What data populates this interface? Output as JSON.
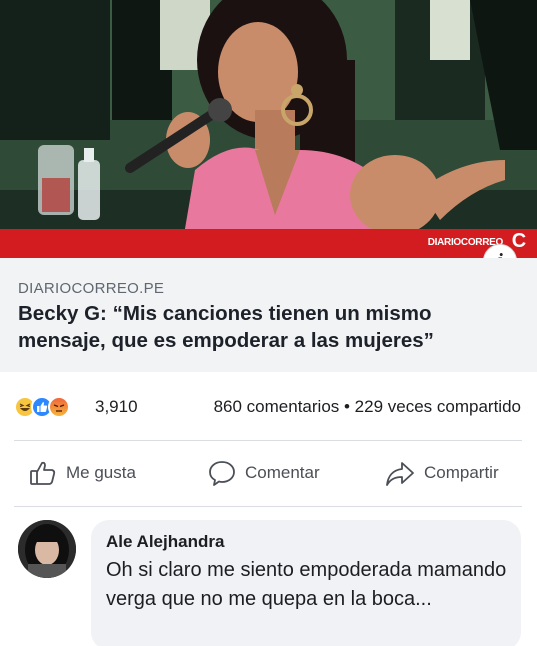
{
  "article": {
    "watermark": "DIARIOCORREO",
    "domain": "DIARIOCORREO.PE",
    "title": "Becky G: “Mis canciones tienen un mismo mensaje, que es empoderar a las mujeres”",
    "info_icon_glyph": "i"
  },
  "stats": {
    "reactions": [
      "haha",
      "like",
      "angry"
    ],
    "reaction_count": "3,910",
    "comments_shares": "860 comentarios • 229 veces compartido"
  },
  "actions": {
    "like": "Me gusta",
    "comment": "Comentar",
    "share": "Compartir"
  },
  "comment": {
    "author": "Ale Alejhandra",
    "text": "Oh si claro me siento empoderada mamando verga que no me quepa en la boca..."
  },
  "colors": {
    "brand_red": "#d31c20",
    "link_box_bg": "#f2f3f5",
    "comment_bubble_bg": "#f0f2f5",
    "like_blue": "#2d88ff"
  }
}
